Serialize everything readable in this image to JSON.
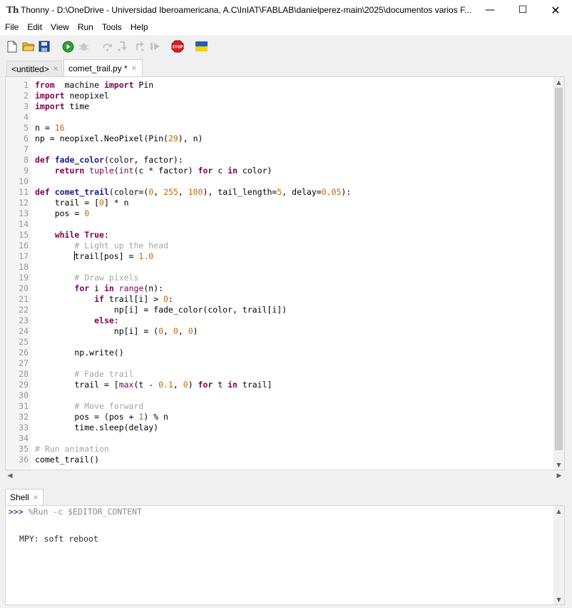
{
  "window": {
    "title": "Thonny  -  D:\\OneDrive - Universidad Iberoamericana, A.C\\InIAT\\FABLAB\\danielperez-main\\2025\\documentos varios F...",
    "minimize": "—",
    "maximize": "☐",
    "close": "✕"
  },
  "menu": {
    "items": [
      "File",
      "Edit",
      "View",
      "Run",
      "Tools",
      "Help"
    ]
  },
  "toolbar": {
    "icons": [
      "new-file-icon",
      "open-folder-icon",
      "save-icon",
      "run-icon",
      "debug-icon",
      "step-over-icon",
      "step-into-icon",
      "step-out-icon",
      "resume-icon",
      "stop-icon",
      "ukraine-flag-icon"
    ],
    "stop_text": "STOP",
    "colors": {
      "run": "#2e9e3e",
      "stop": "#d92020",
      "flag_blue": "#1f5fbf",
      "flag_yellow": "#f5d20a"
    }
  },
  "editor": {
    "tabs": [
      {
        "label": "<untitled>",
        "close": "×",
        "active": false
      },
      {
        "label": "comet_trail.py *",
        "close": "×",
        "active": true
      }
    ],
    "line_numbers": [
      "1",
      "2",
      "3",
      "4",
      "5",
      "6",
      "7",
      "8",
      "9",
      "10",
      "11",
      "12",
      "13",
      "14",
      "15",
      "16",
      "17",
      "18",
      "19",
      "20",
      "21",
      "22",
      "23",
      "24",
      "25",
      "26",
      "27",
      "28",
      "29",
      "30",
      "31",
      "32",
      "33",
      "34",
      "35",
      "36"
    ],
    "lines": [
      [
        [
          "kw",
          "from"
        ],
        [
          "",
          "  machine "
        ],
        [
          "kw",
          "import"
        ],
        [
          "",
          " Pin"
        ]
      ],
      [
        [
          "kw",
          "import"
        ],
        [
          "",
          " neopixel"
        ]
      ],
      [
        [
          "kw",
          "import"
        ],
        [
          "",
          " time"
        ]
      ],
      [],
      [
        [
          "",
          "n = "
        ],
        [
          "num",
          "16"
        ]
      ],
      [
        [
          "",
          "np = neopixel.NeoPixel(Pin("
        ],
        [
          "num",
          "29"
        ],
        [
          "",
          "), n)"
        ]
      ],
      [],
      [
        [
          "kw",
          "def"
        ],
        [
          "",
          " "
        ],
        [
          "fn",
          "fade_color"
        ],
        [
          "",
          "(color, factor):"
        ]
      ],
      [
        [
          "",
          "    "
        ],
        [
          "kw",
          "return"
        ],
        [
          "",
          " "
        ],
        [
          "bi",
          "tuple"
        ],
        [
          "",
          "("
        ],
        [
          "bi",
          "int"
        ],
        [
          "",
          "(c * factor) "
        ],
        [
          "kw",
          "for"
        ],
        [
          "",
          " c "
        ],
        [
          "kw",
          "in"
        ],
        [
          "",
          " color)"
        ]
      ],
      [],
      [
        [
          "kw",
          "def"
        ],
        [
          "",
          " "
        ],
        [
          "fn",
          "comet_trail"
        ],
        [
          "",
          "(color=("
        ],
        [
          "num",
          "0"
        ],
        [
          "",
          ", "
        ],
        [
          "num",
          "255"
        ],
        [
          "",
          ", "
        ],
        [
          "num",
          "100"
        ],
        [
          "",
          "), tail_length="
        ],
        [
          "num",
          "5"
        ],
        [
          "",
          ", delay="
        ],
        [
          "num",
          "0.05"
        ],
        [
          "",
          "):"
        ]
      ],
      [
        [
          "",
          "    trail = ["
        ],
        [
          "num",
          "0"
        ],
        [
          "",
          "] * n"
        ]
      ],
      [
        [
          "",
          "    pos = "
        ],
        [
          "num",
          "0"
        ]
      ],
      [],
      [
        [
          "",
          "    "
        ],
        [
          "kw",
          "while"
        ],
        [
          "",
          " "
        ],
        [
          "kw",
          "True"
        ],
        [
          "",
          ":"
        ]
      ],
      [
        [
          "",
          "        "
        ],
        [
          "cmt",
          "# Light up the head"
        ]
      ],
      [
        [
          "",
          "        "
        ],
        [
          "cursor",
          ""
        ],
        [
          "",
          "trail[pos] = "
        ],
        [
          "num",
          "1.0"
        ]
      ],
      [],
      [
        [
          "",
          "        "
        ],
        [
          "cmt",
          "# Draw pixels"
        ]
      ],
      [
        [
          "",
          "        "
        ],
        [
          "kw",
          "for"
        ],
        [
          "",
          " i "
        ],
        [
          "kw",
          "in"
        ],
        [
          "",
          " "
        ],
        [
          "bi",
          "range"
        ],
        [
          "",
          "(n):"
        ]
      ],
      [
        [
          "",
          "            "
        ],
        [
          "kw",
          "if"
        ],
        [
          "",
          " trail[i] > "
        ],
        [
          "num",
          "0"
        ],
        [
          "",
          ":"
        ]
      ],
      [
        [
          "",
          "                np[i] = fade_color(color, trail[i])"
        ]
      ],
      [
        [
          "",
          "            "
        ],
        [
          "kw",
          "else"
        ],
        [
          "",
          ":"
        ]
      ],
      [
        [
          "",
          "                np[i] = ("
        ],
        [
          "num",
          "0"
        ],
        [
          "",
          ", "
        ],
        [
          "num",
          "0"
        ],
        [
          "",
          ", "
        ],
        [
          "num",
          "0"
        ],
        [
          "",
          ")"
        ]
      ],
      [],
      [
        [
          "",
          "        np.write()"
        ]
      ],
      [],
      [
        [
          "",
          "        "
        ],
        [
          "cmt",
          "# Fade trail"
        ]
      ],
      [
        [
          "",
          "        trail = ["
        ],
        [
          "bi",
          "max"
        ],
        [
          "",
          "(t - "
        ],
        [
          "num",
          "0.1"
        ],
        [
          "",
          ", "
        ],
        [
          "num",
          "0"
        ],
        [
          "",
          ") "
        ],
        [
          "kw",
          "for"
        ],
        [
          "",
          " t "
        ],
        [
          "kw",
          "in"
        ],
        [
          "",
          " trail]"
        ]
      ],
      [],
      [
        [
          "",
          "        "
        ],
        [
          "cmt",
          "# Move forward"
        ]
      ],
      [
        [
          "",
          "        pos = (pos + "
        ],
        [
          "num",
          "1"
        ],
        [
          "",
          ") % n"
        ]
      ],
      [
        [
          "",
          "        time.sleep(delay)"
        ]
      ],
      [],
      [
        [
          "cmt",
          "# Run animation"
        ]
      ],
      [
        [
          "",
          "comet_trail()"
        ]
      ]
    ],
    "scroll_up": "▲",
    "scroll_down": "▼",
    "scroll_left": "◀",
    "scroll_right": "▶"
  },
  "shell": {
    "tab_label": "Shell",
    "tab_close": "×",
    "prompt_symbol": ">>>",
    "command": " %Run -c $EDITOR_CONTENT",
    "output": "MPY: soft reboot",
    "scroll_up": "▲",
    "scroll_down": "▼"
  }
}
